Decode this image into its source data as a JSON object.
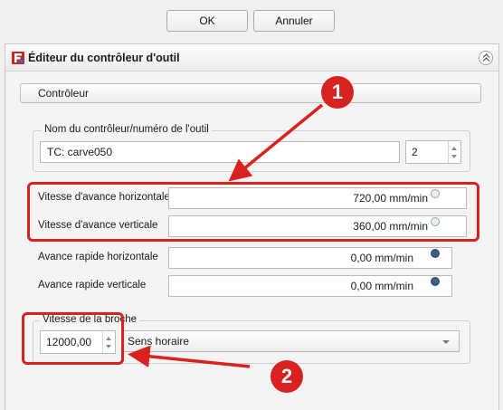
{
  "dialog": {
    "ok_label": "OK",
    "cancel_label": "Annuler"
  },
  "panel": {
    "title": "Éditeur du contrôleur d'outil"
  },
  "section": {
    "label": "Contrôleur"
  },
  "name_group": {
    "legend": "Nom du contrôleur/numéro de l'outil",
    "name_value": "TC: carve050",
    "tool_number": "2"
  },
  "feeds": [
    {
      "label": "Vitesse d'avance horizontale",
      "value": "720,00 mm/min"
    },
    {
      "label": "Vitesse d'avance verticale",
      "value": "360,00 mm/min"
    },
    {
      "label": "Avance rapide horizontale",
      "value": "0,00 mm/min"
    },
    {
      "label": "Avance rapide verticale",
      "value": "0,00 mm/min"
    }
  ],
  "spindle": {
    "legend": "Vitesse de la broche",
    "speed": "12000,00",
    "direction": "Sens horaire"
  },
  "annotations": {
    "badge1": "1",
    "badge2": "2",
    "color": "#d9211f"
  }
}
